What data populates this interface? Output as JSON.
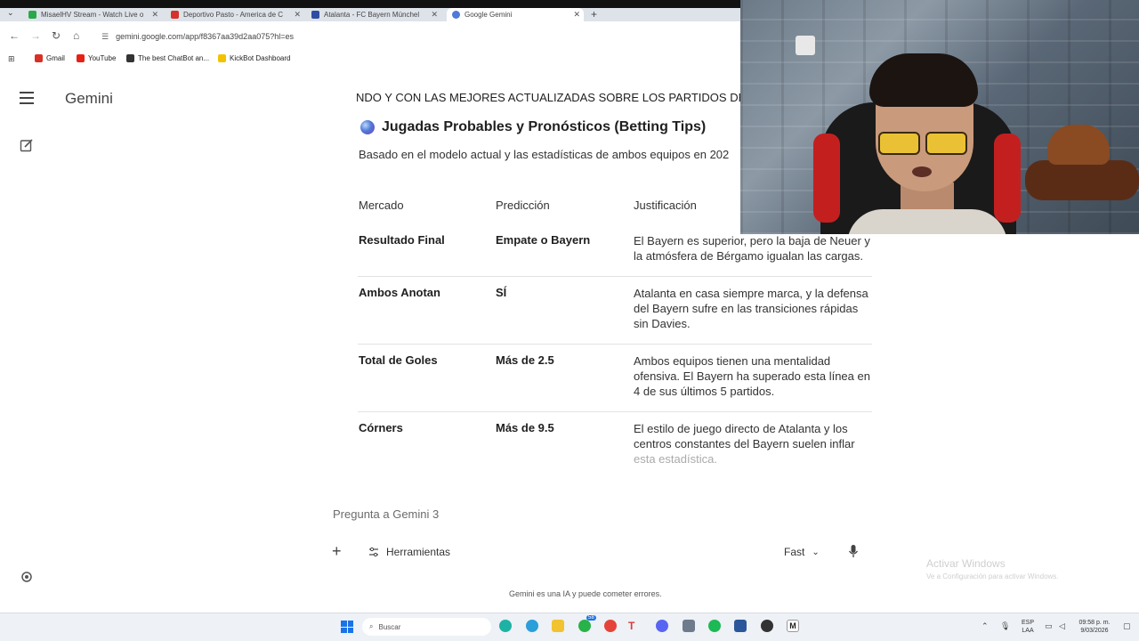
{
  "browser": {
    "tabs": [
      {
        "title": "MisaelHV Stream - Watch Live o",
        "color": "#2aa84a"
      },
      {
        "title": "Deportivo Pasto - America de C",
        "color": "#d4322c"
      },
      {
        "title": "Atalanta - FC Bayern Münchel",
        "color": "#2f4ea3"
      },
      {
        "title": "Google Gemini",
        "color": "#4f7ad6"
      }
    ],
    "new_tab": "+",
    "url": "gemini.google.com/app/f8367aa39d2aa075?hl=es",
    "bookmarks": [
      {
        "label": "Gmail",
        "color": "#d93025"
      },
      {
        "label": "YouTube",
        "color": "#e62117"
      },
      {
        "label": "The best ChatBot an...",
        "color": "#333333"
      },
      {
        "label": "KickBot Dashboard",
        "color": "#f2c200"
      }
    ]
  },
  "gemini": {
    "brand": "Gemini",
    "banner": "NDO Y CON LAS MEJORES ACTUALIZADAS SOBRE LOS PARTIDOS DE",
    "section_title": "Jugadas Probables y Pronósticos (Betting Tips)",
    "intro": "Basado en el modelo actual y las estadísticas de ambos equipos en 202",
    "table": {
      "headers": [
        "Mercado",
        "Predicción",
        "Justificación"
      ],
      "rows": [
        {
          "market": "Resultado Final",
          "prediction": "Empate o Bayern",
          "justification": "El Bayern es superior, pero la baja de Neuer y la atmósfera de Bérgamo igualan las cargas."
        },
        {
          "market": "Ambos Anotan",
          "prediction": "SÍ",
          "justification": "Atalanta en casa siempre marca, y la defensa del Bayern sufre en las transiciones rápidas sin Davies."
        },
        {
          "market": "Total de Goles",
          "prediction": "Más de 2.5",
          "justification": "Ambos equipos tienen una mentalidad ofensiva. El Bayern ha superado esta línea en 4 de sus últimos 5 partidos."
        },
        {
          "market": "Córners",
          "prediction": "Más de 9.5",
          "justification_main": "El estilo de juego directo de Atalanta y los centros constantes del Bayern suelen inflar",
          "justification_faded": "esta estadística."
        }
      ]
    },
    "prompt_placeholder": "Pregunta a Gemini 3",
    "tools_label": "Herramientas",
    "mode_label": "Fast",
    "disclaimer": "Gemini es una IA y puede cometer errores."
  },
  "watermark": {
    "line1": "Activar Windows",
    "line2": "Ve a Configuración para activar Windows."
  },
  "taskbar": {
    "search_placeholder": "Buscar",
    "whatsapp_badge": "58",
    "lang_top": "ESP",
    "lang_bottom": "LAA",
    "time": "09:58 p. m.",
    "date": "9/03/2026"
  }
}
